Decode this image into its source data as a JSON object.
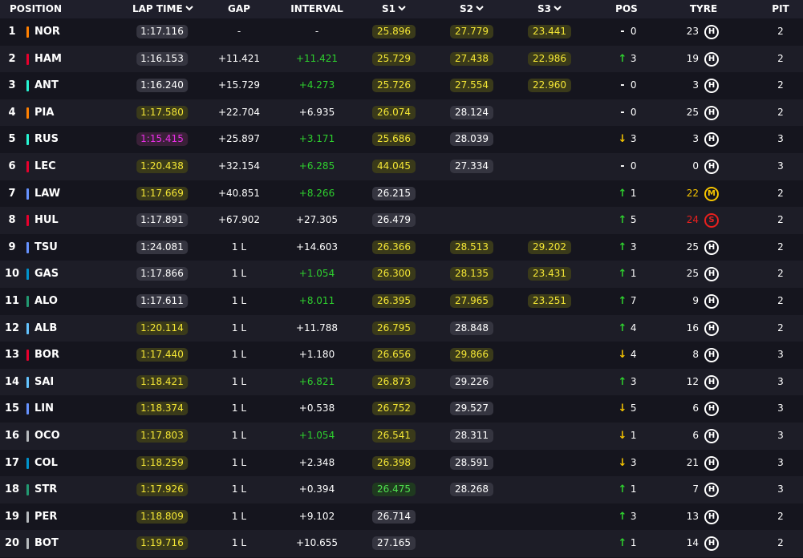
{
  "header": {
    "position": "POSITION",
    "lap_time": "LAP TIME",
    "gap": "GAP",
    "interval": "INTERVAL",
    "s1": "S1",
    "s2": "S2",
    "s3": "S3",
    "pos": "POS",
    "tyre": "TYRE",
    "pit": "PIT"
  },
  "colors": {
    "background": "#15151e",
    "row_alt": "#1d1d27",
    "yellow": "#f5e735",
    "green": "#2ed02e",
    "purple": "#e82ee8",
    "medium_tyre": "#f5c400",
    "soft_tyre": "#e8201e"
  },
  "rows": [
    {
      "pos": "1",
      "code": "NOR",
      "team_color": "#ff8000",
      "lap": "1:17.116",
      "lap_style": "plain",
      "gap": "-",
      "interval": "-",
      "interval_style": "white",
      "s1": "25.896",
      "s1_style": "yellow",
      "s2": "27.779",
      "s2_style": "yellow",
      "s3": "23.441",
      "s3_style": "yellow",
      "delta_dir": "none",
      "delta": "0",
      "laps": "23",
      "tyre": "hard",
      "tyre_letter": "H",
      "pit": "2"
    },
    {
      "pos": "2",
      "code": "HAM",
      "team_color": "#e8002d",
      "lap": "1:16.153",
      "lap_style": "plain",
      "gap": "+11.421",
      "interval": "+11.421",
      "interval_style": "green",
      "s1": "25.729",
      "s1_style": "yellow",
      "s2": "27.438",
      "s2_style": "yellow",
      "s3": "22.986",
      "s3_style": "yellow",
      "delta_dir": "up",
      "delta": "3",
      "laps": "19",
      "tyre": "hard",
      "tyre_letter": "H",
      "pit": "2"
    },
    {
      "pos": "3",
      "code": "ANT",
      "team_color": "#27f4d2",
      "lap": "1:16.240",
      "lap_style": "plain",
      "gap": "+15.729",
      "interval": "+4.273",
      "interval_style": "green",
      "s1": "25.726",
      "s1_style": "yellow",
      "s2": "27.554",
      "s2_style": "yellow",
      "s3": "22.960",
      "s3_style": "yellow",
      "delta_dir": "none",
      "delta": "0",
      "laps": "3",
      "tyre": "hard",
      "tyre_letter": "H",
      "pit": "2"
    },
    {
      "pos": "4",
      "code": "PIA",
      "team_color": "#ff8000",
      "lap": "1:17.580",
      "lap_style": "yellow",
      "gap": "+22.704",
      "interval": "+6.935",
      "interval_style": "white",
      "s1": "26.074",
      "s1_style": "yellow",
      "s2": "28.124",
      "s2_style": "plain",
      "s3": "",
      "s3_style": "none",
      "delta_dir": "none",
      "delta": "0",
      "laps": "25",
      "tyre": "hard",
      "tyre_letter": "H",
      "pit": "2"
    },
    {
      "pos": "5",
      "code": "RUS",
      "team_color": "#27f4d2",
      "lap": "1:15.415",
      "lap_style": "purple",
      "gap": "+25.897",
      "interval": "+3.171",
      "interval_style": "green",
      "s1": "25.686",
      "s1_style": "yellow",
      "s2": "28.039",
      "s2_style": "plain",
      "s3": "",
      "s3_style": "none",
      "delta_dir": "down",
      "delta": "3",
      "laps": "3",
      "tyre": "hard",
      "tyre_letter": "H",
      "pit": "3"
    },
    {
      "pos": "6",
      "code": "LEC",
      "team_color": "#e8002d",
      "lap": "1:20.438",
      "lap_style": "yellow",
      "gap": "+32.154",
      "interval": "+6.285",
      "interval_style": "green",
      "s1": "44.045",
      "s1_style": "yellow",
      "s2": "27.334",
      "s2_style": "plain",
      "s3": "",
      "s3_style": "none",
      "delta_dir": "none",
      "delta": "0",
      "laps": "0",
      "tyre": "hard",
      "tyre_letter": "H",
      "pit": "3"
    },
    {
      "pos": "7",
      "code": "LAW",
      "team_color": "#6692ff",
      "lap": "1:17.669",
      "lap_style": "yellow",
      "gap": "+40.851",
      "interval": "+8.266",
      "interval_style": "green",
      "s1": "26.215",
      "s1_style": "plain",
      "s2": "",
      "s2_style": "none",
      "s3": "",
      "s3_style": "none",
      "delta_dir": "up",
      "delta": "1",
      "laps": "22",
      "tyre": "medium",
      "tyre_letter": "M",
      "pit": "2"
    },
    {
      "pos": "8",
      "code": "HUL",
      "team_color": "#e8002d",
      "lap": "1:17.891",
      "lap_style": "plain",
      "gap": "+67.902",
      "interval": "+27.305",
      "interval_style": "white",
      "s1": "26.479",
      "s1_style": "plain",
      "s2": "",
      "s2_style": "none",
      "s3": "",
      "s3_style": "none",
      "delta_dir": "up",
      "delta": "5",
      "laps": "24",
      "tyre": "soft",
      "tyre_letter": "S",
      "pit": "2"
    },
    {
      "pos": "9",
      "code": "TSU",
      "team_color": "#6692ff",
      "lap": "1:24.081",
      "lap_style": "plain",
      "gap": "1 L",
      "interval": "+14.603",
      "interval_style": "white",
      "s1": "26.366",
      "s1_style": "yellow",
      "s2": "28.513",
      "s2_style": "yellow",
      "s3": "29.202",
      "s3_style": "yellow",
      "delta_dir": "up",
      "delta": "3",
      "laps": "25",
      "tyre": "hard",
      "tyre_letter": "H",
      "pit": "2"
    },
    {
      "pos": "10",
      "code": "GAS",
      "team_color": "#0093cc",
      "lap": "1:17.866",
      "lap_style": "plain",
      "gap": "1 L",
      "interval": "+1.054",
      "interval_style": "green",
      "s1": "26.300",
      "s1_style": "yellow",
      "s2": "28.135",
      "s2_style": "yellow",
      "s3": "23.431",
      "s3_style": "yellow",
      "delta_dir": "up",
      "delta": "1",
      "laps": "25",
      "tyre": "hard",
      "tyre_letter": "H",
      "pit": "2"
    },
    {
      "pos": "11",
      "code": "ALO",
      "team_color": "#229971",
      "lap": "1:17.611",
      "lap_style": "plain",
      "gap": "1 L",
      "interval": "+8.011",
      "interval_style": "green",
      "s1": "26.395",
      "s1_style": "yellow",
      "s2": "27.965",
      "s2_style": "yellow",
      "s3": "23.251",
      "s3_style": "yellow",
      "delta_dir": "up",
      "delta": "7",
      "laps": "9",
      "tyre": "hard",
      "tyre_letter": "H",
      "pit": "2"
    },
    {
      "pos": "12",
      "code": "ALB",
      "team_color": "#64c4ff",
      "lap": "1:20.114",
      "lap_style": "yellow",
      "gap": "1 L",
      "interval": "+11.788",
      "interval_style": "white",
      "s1": "26.795",
      "s1_style": "yellow",
      "s2": "28.848",
      "s2_style": "plain",
      "s3": "",
      "s3_style": "none",
      "delta_dir": "up",
      "delta": "4",
      "laps": "16",
      "tyre": "hard",
      "tyre_letter": "H",
      "pit": "2"
    },
    {
      "pos": "13",
      "code": "BOR",
      "team_color": "#e8002d",
      "lap": "1:17.440",
      "lap_style": "yellow",
      "gap": "1 L",
      "interval": "+1.180",
      "interval_style": "white",
      "s1": "26.656",
      "s1_style": "yellow",
      "s2": "29.866",
      "s2_style": "yellow",
      "s3": "",
      "s3_style": "none",
      "delta_dir": "down",
      "delta": "4",
      "laps": "8",
      "tyre": "hard",
      "tyre_letter": "H",
      "pit": "3"
    },
    {
      "pos": "14",
      "code": "SAI",
      "team_color": "#64c4ff",
      "lap": "1:18.421",
      "lap_style": "yellow",
      "gap": "1 L",
      "interval": "+6.821",
      "interval_style": "green",
      "s1": "26.873",
      "s1_style": "yellow",
      "s2": "29.226",
      "s2_style": "plain",
      "s3": "",
      "s3_style": "none",
      "delta_dir": "up",
      "delta": "3",
      "laps": "12",
      "tyre": "hard",
      "tyre_letter": "H",
      "pit": "3"
    },
    {
      "pos": "15",
      "code": "LIN",
      "team_color": "#6692ff",
      "lap": "1:18.374",
      "lap_style": "yellow",
      "gap": "1 L",
      "interval": "+0.538",
      "interval_style": "white",
      "s1": "26.752",
      "s1_style": "yellow",
      "s2": "29.527",
      "s2_style": "plain",
      "s3": "",
      "s3_style": "none",
      "delta_dir": "down",
      "delta": "5",
      "laps": "6",
      "tyre": "hard",
      "tyre_letter": "H",
      "pit": "3"
    },
    {
      "pos": "16",
      "code": "OCO",
      "team_color": "#b6babd",
      "lap": "1:17.803",
      "lap_style": "yellow",
      "gap": "1 L",
      "interval": "+1.054",
      "interval_style": "green",
      "s1": "26.541",
      "s1_style": "yellow",
      "s2": "28.311",
      "s2_style": "plain",
      "s3": "",
      "s3_style": "none",
      "delta_dir": "down",
      "delta": "1",
      "laps": "6",
      "tyre": "hard",
      "tyre_letter": "H",
      "pit": "3"
    },
    {
      "pos": "17",
      "code": "COL",
      "team_color": "#0093cc",
      "lap": "1:18.259",
      "lap_style": "yellow",
      "gap": "1 L",
      "interval": "+2.348",
      "interval_style": "white",
      "s1": "26.398",
      "s1_style": "yellow",
      "s2": "28.591",
      "s2_style": "plain",
      "s3": "",
      "s3_style": "none",
      "delta_dir": "down",
      "delta": "3",
      "laps": "21",
      "tyre": "hard",
      "tyre_letter": "H",
      "pit": "3"
    },
    {
      "pos": "18",
      "code": "STR",
      "team_color": "#229971",
      "lap": "1:17.926",
      "lap_style": "yellow",
      "gap": "1 L",
      "interval": "+0.394",
      "interval_style": "white",
      "s1": "26.475",
      "s1_style": "green",
      "s2": "28.268",
      "s2_style": "plain",
      "s3": "",
      "s3_style": "none",
      "delta_dir": "up",
      "delta": "1",
      "laps": "7",
      "tyre": "hard",
      "tyre_letter": "H",
      "pit": "3"
    },
    {
      "pos": "19",
      "code": "PER",
      "team_color": "#b6babd",
      "lap": "1:18.809",
      "lap_style": "yellow",
      "gap": "1 L",
      "interval": "+9.102",
      "interval_style": "white",
      "s1": "26.714",
      "s1_style": "plain",
      "s2": "",
      "s2_style": "none",
      "s3": "",
      "s3_style": "none",
      "delta_dir": "up",
      "delta": "3",
      "laps": "13",
      "tyre": "hard",
      "tyre_letter": "H",
      "pit": "2"
    },
    {
      "pos": "20",
      "code": "BOT",
      "team_color": "#b6babd",
      "lap": "1:19.716",
      "lap_style": "yellow",
      "gap": "1 L",
      "interval": "+10.655",
      "interval_style": "white",
      "s1": "27.165",
      "s1_style": "plain",
      "s2": "",
      "s2_style": "none",
      "s3": "",
      "s3_style": "none",
      "delta_dir": "up",
      "delta": "1",
      "laps": "14",
      "tyre": "hard",
      "tyre_letter": "H",
      "pit": "2"
    }
  ]
}
